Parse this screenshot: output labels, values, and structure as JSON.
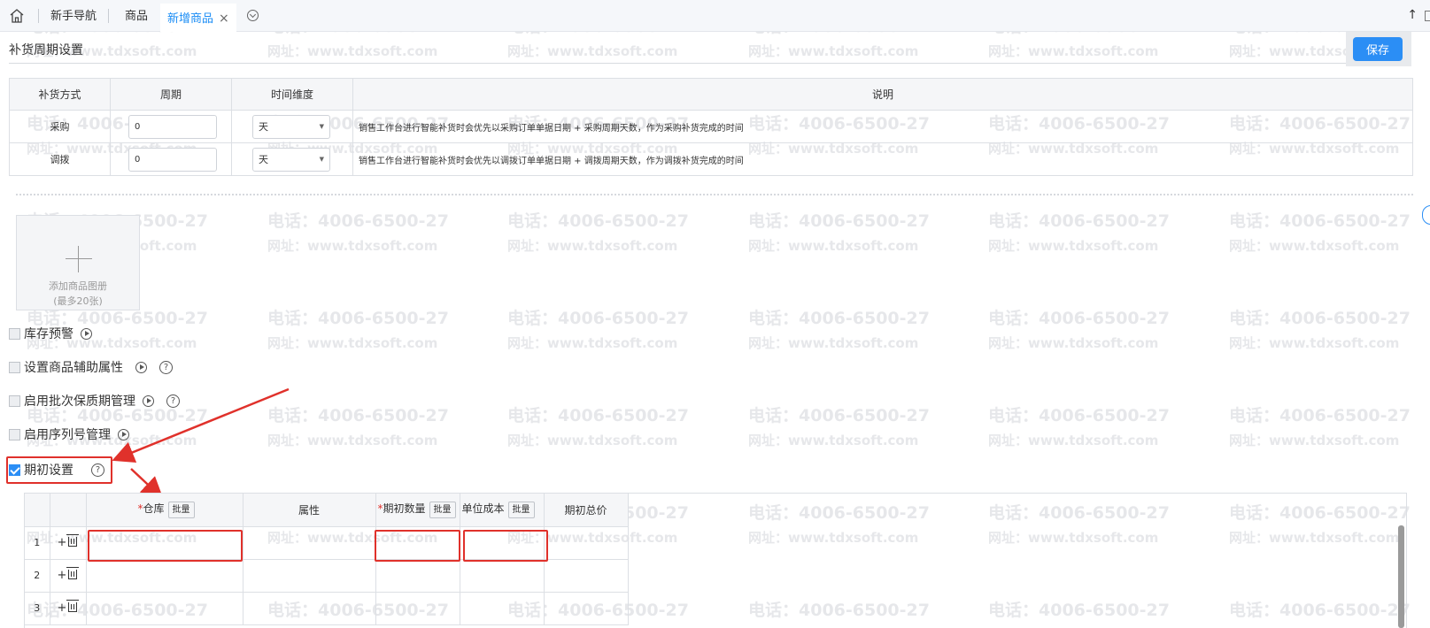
{
  "tabs": {
    "items": [
      {
        "label": "新手导航"
      },
      {
        "label": "商品"
      },
      {
        "label": "新增商品",
        "close": "×"
      }
    ]
  },
  "section": {
    "title": "补货周期设置",
    "save_label": "保存"
  },
  "replenish_table": {
    "headers": [
      "补货方式",
      "周期",
      "时间维度",
      "说明"
    ],
    "rows": [
      {
        "method": "采购",
        "period": "0",
        "dimension": "天",
        "desc": "销售工作台进行智能补货时会优先以采购订单单据日期 + 采购周期天数，作为采购补货完成的时间"
      },
      {
        "method": "调拨",
        "period": "0",
        "dimension": "天",
        "desc": "销售工作台进行智能补货时会优先以调拨订单单据日期 + 调拨周期天数，作为调拨补货完成的时间"
      }
    ]
  },
  "upload": {
    "line1": "添加商品图册",
    "line2": "(最多20张)"
  },
  "options": [
    {
      "label": "库存预警",
      "checked": false
    },
    {
      "label": "设置商品辅助属性",
      "checked": false
    },
    {
      "label": "启用批次保质期管理",
      "checked": false
    },
    {
      "label": "启用序列号管理",
      "checked": false
    },
    {
      "label": "期初设置",
      "checked": true
    }
  ],
  "opening_table": {
    "headers": {
      "warehouse": "仓库",
      "bulk": "批量",
      "attr": "属性",
      "qty": "期初数量",
      "cost": "单位成本",
      "total": "期初总价"
    },
    "required_mark": "*",
    "rows": [
      "1",
      "2",
      "3"
    ],
    "add": "+"
  },
  "watermark": {
    "line1": "电话：4006-6500-27",
    "line2": "网址：www.tdxsoft.com"
  },
  "colors": {
    "accent": "#2b8ef5",
    "highlight": "#e0312b"
  }
}
